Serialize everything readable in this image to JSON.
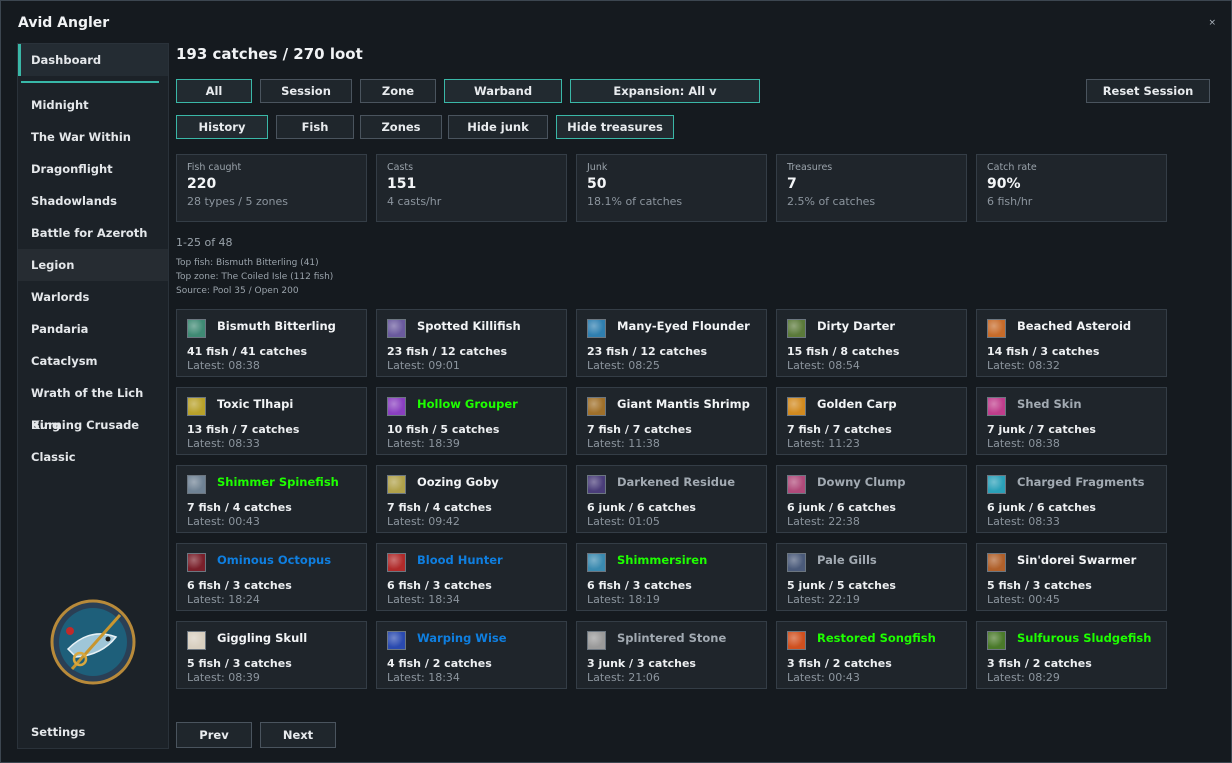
{
  "app": {
    "title": "Avid Angler",
    "close_label": "×"
  },
  "sidebar": {
    "items": [
      "Dashboard",
      "Midnight",
      "The War Within",
      "Dragonflight",
      "Shadowlands",
      "Battle for Azeroth",
      "Legion",
      "Warlords",
      "Pandaria",
      "Cataclysm",
      "Wrath of the Lich King",
      "Burning Crusade",
      "Classic"
    ],
    "active": "Dashboard",
    "settings_label": "Settings"
  },
  "header": {
    "title": "193 catches / 270 loot"
  },
  "filters": {
    "row1": [
      "All",
      "Session",
      "Zone",
      "Warband",
      "Expansion: All v"
    ],
    "row2": [
      "History",
      "Fish",
      "Zones",
      "Hide junk",
      "Hide treasures"
    ],
    "reset_label": "Reset Session"
  },
  "stats": [
    {
      "label": "Fish caught",
      "value": "220",
      "sub": "28 types / 5 zones"
    },
    {
      "label": "Casts",
      "value": "151",
      "sub": "4 casts/hr"
    },
    {
      "label": "Junk",
      "value": "50",
      "sub": "18.1% of catches"
    },
    {
      "label": "Treasures",
      "value": "7",
      "sub": "2.5% of catches"
    },
    {
      "label": "Catch rate",
      "value": "90%",
      "sub": "6 fish/hr"
    }
  ],
  "list_meta": {
    "range": "1-25 of 48",
    "top_fish": "Top fish: Bismuth Bitterling (41)",
    "top_zone": "Top zone: The Coiled Isle (112 fish)",
    "source": "Source: Pool 35 / Open 200"
  },
  "cards": [
    {
      "name": "Bismuth Bitterling",
      "stats": "41 fish / 41 catches",
      "latest": "Latest: 08:38",
      "quality": "common",
      "icon": "bismuth-bitterling-icon",
      "color": "#3f8a74"
    },
    {
      "name": "Spotted Killifish",
      "stats": "23 fish / 12 catches",
      "latest": "Latest: 09:01",
      "quality": "common",
      "icon": "spotted-killifish-icon",
      "color": "#6a5a9e"
    },
    {
      "name": "Many-Eyed Flounder",
      "stats": "23 fish / 12 catches",
      "latest": "Latest: 08:25",
      "quality": "common",
      "icon": "many-eyed-flounder-icon",
      "color": "#2f7fb0"
    },
    {
      "name": "Dirty Darter",
      "stats": "15 fish / 8 catches",
      "latest": "Latest: 08:54",
      "quality": "common",
      "icon": "dirty-darter-icon",
      "color": "#5b7a3a"
    },
    {
      "name": "Beached Asteroid",
      "stats": "14 fish / 3 catches",
      "latest": "Latest: 08:32",
      "quality": "common",
      "icon": "beached-asteroid-icon",
      "color": "#c76b2a"
    },
    {
      "name": "Toxic Tlhapi",
      "stats": "13 fish / 7 catches",
      "latest": "Latest: 08:33",
      "quality": "common",
      "icon": "toxic-tlhapi-icon",
      "color": "#b8a12a"
    },
    {
      "name": "Hollow Grouper",
      "stats": "10 fish / 5 catches",
      "latest": "Latest: 18:39",
      "quality": "uncommon",
      "icon": "hollow-grouper-icon",
      "color": "#8a3fc0"
    },
    {
      "name": "Giant Mantis Shrimp",
      "stats": "7 fish / 7 catches",
      "latest": "Latest: 11:38",
      "quality": "common",
      "icon": "giant-mantis-shrimp-icon",
      "color": "#a0702a"
    },
    {
      "name": "Golden Carp",
      "stats": "7 fish / 7 catches",
      "latest": "Latest: 11:23",
      "quality": "common",
      "icon": "golden-carp-icon",
      "color": "#d28a1f"
    },
    {
      "name": "Shed Skin",
      "stats": "7 junk / 7 catches",
      "latest": "Latest: 08:38",
      "quality": "poor",
      "icon": "shed-skin-icon",
      "color": "#c03d8c"
    },
    {
      "name": "Shimmer Spinefish",
      "stats": "7 fish / 4 catches",
      "latest": "Latest: 00:43",
      "quality": "uncommon",
      "icon": "shimmer-spinefish-icon",
      "color": "#6f8294"
    },
    {
      "name": "Oozing Goby",
      "stats": "7 fish / 4 catches",
      "latest": "Latest: 09:42",
      "quality": "common",
      "icon": "oozing-goby-icon",
      "color": "#b0a14a"
    },
    {
      "name": "Darkened Residue",
      "stats": "6 junk / 6 catches",
      "latest": "Latest: 01:05",
      "quality": "poor",
      "icon": "darkened-residue-icon",
      "color": "#4a3d7a"
    },
    {
      "name": "Downy Clump",
      "stats": "6 junk / 6 catches",
      "latest": "Latest: 22:38",
      "quality": "poor",
      "icon": "downy-clump-icon",
      "color": "#b04a7a"
    },
    {
      "name": "Charged Fragments",
      "stats": "6 junk / 6 catches",
      "latest": "Latest: 08:33",
      "quality": "poor",
      "icon": "charged-fragments-icon",
      "color": "#2aa0b8"
    },
    {
      "name": "Ominous Octopus",
      "stats": "6 fish / 3 catches",
      "latest": "Latest: 18:24",
      "quality": "rare",
      "icon": "ominous-octopus-icon",
      "color": "#7a1f2a"
    },
    {
      "name": "Blood Hunter",
      "stats": "6 fish / 3 catches",
      "latest": "Latest: 18:34",
      "quality": "rare",
      "icon": "blood-hunter-icon",
      "color": "#b02a2a"
    },
    {
      "name": "Shimmersiren",
      "stats": "6 fish / 3 catches",
      "latest": "Latest: 18:19",
      "quality": "uncommon",
      "icon": "shimmersiren-icon",
      "color": "#3a8ab0"
    },
    {
      "name": "Pale Gills",
      "stats": "5 junk / 5 catches",
      "latest": "Latest: 22:19",
      "quality": "poor",
      "icon": "pale-gills-icon",
      "color": "#4a5a7a"
    },
    {
      "name": "Sin'dorei Swarmer",
      "stats": "5 fish / 3 catches",
      "latest": "Latest: 00:45",
      "quality": "common",
      "icon": "sindorei-swarmer-icon",
      "color": "#b0602a"
    },
    {
      "name": "Giggling Skull",
      "stats": "5 fish / 3 catches",
      "latest": "Latest: 08:39",
      "quality": "common",
      "icon": "giggling-skull-icon",
      "color": "#d8cfc0"
    },
    {
      "name": "Warping Wise",
      "stats": "4 fish / 2 catches",
      "latest": "Latest: 18:34",
      "quality": "rare",
      "icon": "warping-wise-icon",
      "color": "#2a4ab0"
    },
    {
      "name": "Splintered Stone",
      "stats": "3 junk / 3 catches",
      "latest": "Latest: 21:06",
      "quality": "poor",
      "icon": "splintered-stone-icon",
      "color": "#9a9a9a"
    },
    {
      "name": "Restored Songfish",
      "stats": "3 fish / 2 catches",
      "latest": "Latest: 00:43",
      "quality": "uncommon",
      "icon": "restored-songfish-icon",
      "color": "#d0501f"
    },
    {
      "name": "Sulfurous Sludgefish",
      "stats": "3 fish / 2 catches",
      "latest": "Latest: 08:29",
      "quality": "uncommon",
      "icon": "sulfurous-sludgefish-icon",
      "color": "#4a7a2a"
    }
  ],
  "pagination": {
    "prev_label": "Prev",
    "next_label": "Next"
  }
}
